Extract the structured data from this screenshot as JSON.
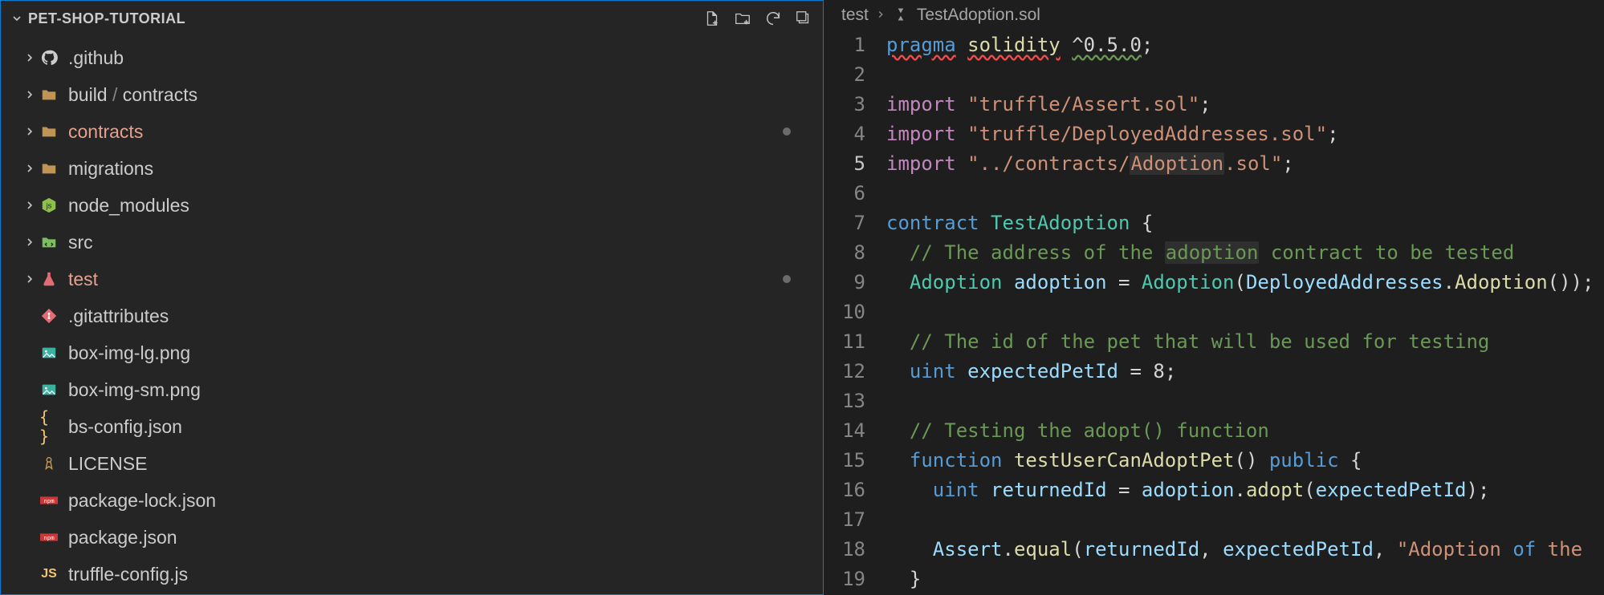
{
  "sidebar": {
    "title": "PET-SHOP-TUTORIAL",
    "items": [
      {
        "label": ".github",
        "icon": "github",
        "chevron": true,
        "modified": false
      },
      {
        "label_pre": "build",
        "label_sep": " / ",
        "label_post": "contracts",
        "icon": "folder",
        "chevron": true,
        "modified": false
      },
      {
        "label": "contracts",
        "icon": "folder",
        "chevron": true,
        "modified": true
      },
      {
        "label": "migrations",
        "icon": "folder",
        "chevron": true,
        "modified": false
      },
      {
        "label": "node_modules",
        "icon": "node",
        "chevron": true,
        "modified": false
      },
      {
        "label": "src",
        "icon": "src",
        "chevron": true,
        "modified": false
      },
      {
        "label": "test",
        "icon": "test",
        "chevron": true,
        "modified": true
      },
      {
        "label": ".gitattributes",
        "icon": "git",
        "chevron": false
      },
      {
        "label": "box-img-lg.png",
        "icon": "img",
        "chevron": false
      },
      {
        "label": "box-img-sm.png",
        "icon": "img",
        "chevron": false
      },
      {
        "label": "bs-config.json",
        "icon": "json",
        "chevron": false
      },
      {
        "label": "LICENSE",
        "icon": "license",
        "chevron": false
      },
      {
        "label": "package-lock.json",
        "icon": "npm",
        "chevron": false
      },
      {
        "label": "package.json",
        "icon": "npm",
        "chevron": false
      },
      {
        "label": "truffle-config.js",
        "icon": "js",
        "chevron": false
      }
    ]
  },
  "breadcrumb": {
    "seg1": "test",
    "seg2": "TestAdoption.sol"
  },
  "code": {
    "lines": [
      {
        "n": "1",
        "t": [
          [
            "pragma",
            "kw ul"
          ],
          [
            " ",
            "plain"
          ],
          [
            "solidity",
            "fn ul"
          ],
          [
            " ",
            "plain"
          ],
          [
            "^0.5.0",
            "plain ulg"
          ],
          [
            ";",
            "punc"
          ]
        ]
      },
      {
        "n": "2",
        "t": []
      },
      {
        "n": "3",
        "t": [
          [
            "import",
            "warn"
          ],
          [
            " ",
            "plain"
          ],
          [
            "\"truffle/Assert.sol\"",
            "str"
          ],
          [
            ";",
            "punc"
          ]
        ]
      },
      {
        "n": "4",
        "t": [
          [
            "import",
            "warn"
          ],
          [
            " ",
            "plain"
          ],
          [
            "\"truffle/DeployedAddresses.sol\"",
            "str"
          ],
          [
            ";",
            "punc"
          ]
        ]
      },
      {
        "n": "5",
        "t": [
          [
            "import",
            "warn"
          ],
          [
            " ",
            "plain"
          ],
          [
            "\"../contracts/",
            "str"
          ],
          [
            "Adoption",
            "str hl"
          ],
          [
            ".sol\"",
            "str"
          ],
          [
            ";",
            "punc"
          ]
        ],
        "current": true
      },
      {
        "n": "6",
        "t": []
      },
      {
        "n": "7",
        "t": [
          [
            "contract",
            "kw"
          ],
          [
            " ",
            "plain"
          ],
          [
            "TestAdoption",
            "type"
          ],
          [
            " {",
            "punc"
          ]
        ]
      },
      {
        "n": "8",
        "t": [
          [
            "  ",
            "plain"
          ],
          [
            "// The address of the ",
            "com"
          ],
          [
            "adoption",
            "com hl"
          ],
          [
            " contract to be tested",
            "com"
          ]
        ]
      },
      {
        "n": "9",
        "t": [
          [
            "  ",
            "plain"
          ],
          [
            "Adoption",
            "type"
          ],
          [
            " ",
            "plain"
          ],
          [
            "adoption",
            "var"
          ],
          [
            " = ",
            "plain"
          ],
          [
            "Adoption",
            "type"
          ],
          [
            "(",
            "punc"
          ],
          [
            "DeployedAddresses",
            "var"
          ],
          [
            ".",
            "punc"
          ],
          [
            "Adoption",
            "fn"
          ],
          [
            "());",
            "punc"
          ]
        ]
      },
      {
        "n": "10",
        "t": []
      },
      {
        "n": "11",
        "t": [
          [
            "  ",
            "plain"
          ],
          [
            "// The id of the pet that will be used for testing",
            "com"
          ]
        ]
      },
      {
        "n": "12",
        "t": [
          [
            "  ",
            "plain"
          ],
          [
            "uint",
            "kw"
          ],
          [
            " ",
            "plain"
          ],
          [
            "expectedPetId",
            "var"
          ],
          [
            " = ",
            "plain"
          ],
          [
            "8",
            "plain"
          ],
          [
            ";",
            "punc"
          ]
        ]
      },
      {
        "n": "13",
        "t": []
      },
      {
        "n": "14",
        "t": [
          [
            "  ",
            "plain"
          ],
          [
            "// Testing the adopt() function",
            "com"
          ]
        ]
      },
      {
        "n": "15",
        "t": [
          [
            "  ",
            "plain"
          ],
          [
            "function",
            "kw"
          ],
          [
            " ",
            "plain"
          ],
          [
            "testUserCanAdoptPet",
            "fn"
          ],
          [
            "()",
            "punc"
          ],
          [
            " ",
            "plain"
          ],
          [
            "public",
            "kw"
          ],
          [
            " {",
            "punc"
          ]
        ]
      },
      {
        "n": "16",
        "t": [
          [
            "    ",
            "plain"
          ],
          [
            "uint",
            "kw"
          ],
          [
            " ",
            "plain"
          ],
          [
            "returnedId",
            "var"
          ],
          [
            " = ",
            "plain"
          ],
          [
            "adoption",
            "var"
          ],
          [
            ".",
            "punc"
          ],
          [
            "adopt",
            "fn"
          ],
          [
            "(",
            "punc"
          ],
          [
            "expectedPetId",
            "var"
          ],
          [
            ");",
            "punc"
          ]
        ]
      },
      {
        "n": "17",
        "t": []
      },
      {
        "n": "18",
        "t": [
          [
            "    ",
            "plain"
          ],
          [
            "Assert",
            "var"
          ],
          [
            ".",
            "punc"
          ],
          [
            "equal",
            "fn"
          ],
          [
            "(",
            "punc"
          ],
          [
            "returnedId",
            "var"
          ],
          [
            ", ",
            "punc"
          ],
          [
            "expectedPetId",
            "var"
          ],
          [
            ", ",
            "punc"
          ],
          [
            "\"Adoption",
            "str"
          ],
          [
            " ",
            "str"
          ],
          [
            "of",
            "kw"
          ],
          [
            " ",
            "str"
          ],
          [
            "the ",
            "str"
          ]
        ]
      },
      {
        "n": "19",
        "t": [
          [
            "  }",
            "punc"
          ]
        ]
      }
    ]
  }
}
